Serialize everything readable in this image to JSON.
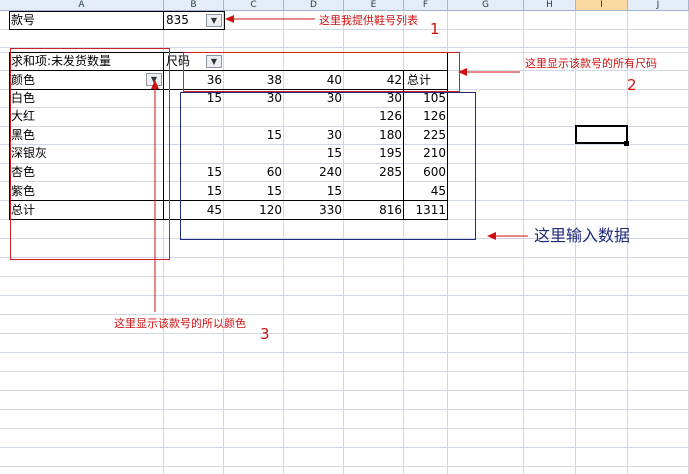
{
  "columns": [
    "A",
    "B",
    "C",
    "D",
    "E",
    "F",
    "G",
    "H",
    "I",
    "J"
  ],
  "selected_column": "I",
  "style_filter": {
    "label": "款号",
    "value": "835"
  },
  "pivot": {
    "title": "求和项:未发货数量",
    "col_field": "尺码",
    "row_field": "颜色",
    "sizes": [
      "36",
      "38",
      "40",
      "42"
    ],
    "total_label": "总计",
    "rows": [
      {
        "color": "白色",
        "values": [
          "15",
          "30",
          "30",
          "30"
        ],
        "total": "105"
      },
      {
        "color": "大红",
        "values": [
          "",
          "",
          "",
          "126"
        ],
        "total": "126"
      },
      {
        "color": "黑色",
        "values": [
          "",
          "15",
          "30",
          "180"
        ],
        "total": "225"
      },
      {
        "color": "深银灰",
        "values": [
          "",
          "",
          "15",
          "195"
        ],
        "total": "210"
      },
      {
        "color": "杏色",
        "values": [
          "15",
          "60",
          "240",
          "285"
        ],
        "total": "600"
      },
      {
        "color": "紫色",
        "values": [
          "15",
          "15",
          "15",
          ""
        ],
        "total": "45"
      }
    ],
    "grand": {
      "label": "总计",
      "values": [
        "45",
        "120",
        "330",
        "816"
      ],
      "total": "1311"
    }
  },
  "annotations": {
    "a1": {
      "text": "这里我提供鞋号列表",
      "num": "1"
    },
    "a2": {
      "text": "这里显示该款号的所有尺码",
      "num": "2"
    },
    "a3": {
      "text": "这里显示该款号的所以颜色",
      "num": "3"
    },
    "a4": {
      "text": "这里输入数据"
    }
  },
  "colors": {
    "annotation_red": "#d01010",
    "annotation_blue": "#1f2a7a",
    "header_bg": "#e4ecf7",
    "grid": "#d0d7e5"
  }
}
